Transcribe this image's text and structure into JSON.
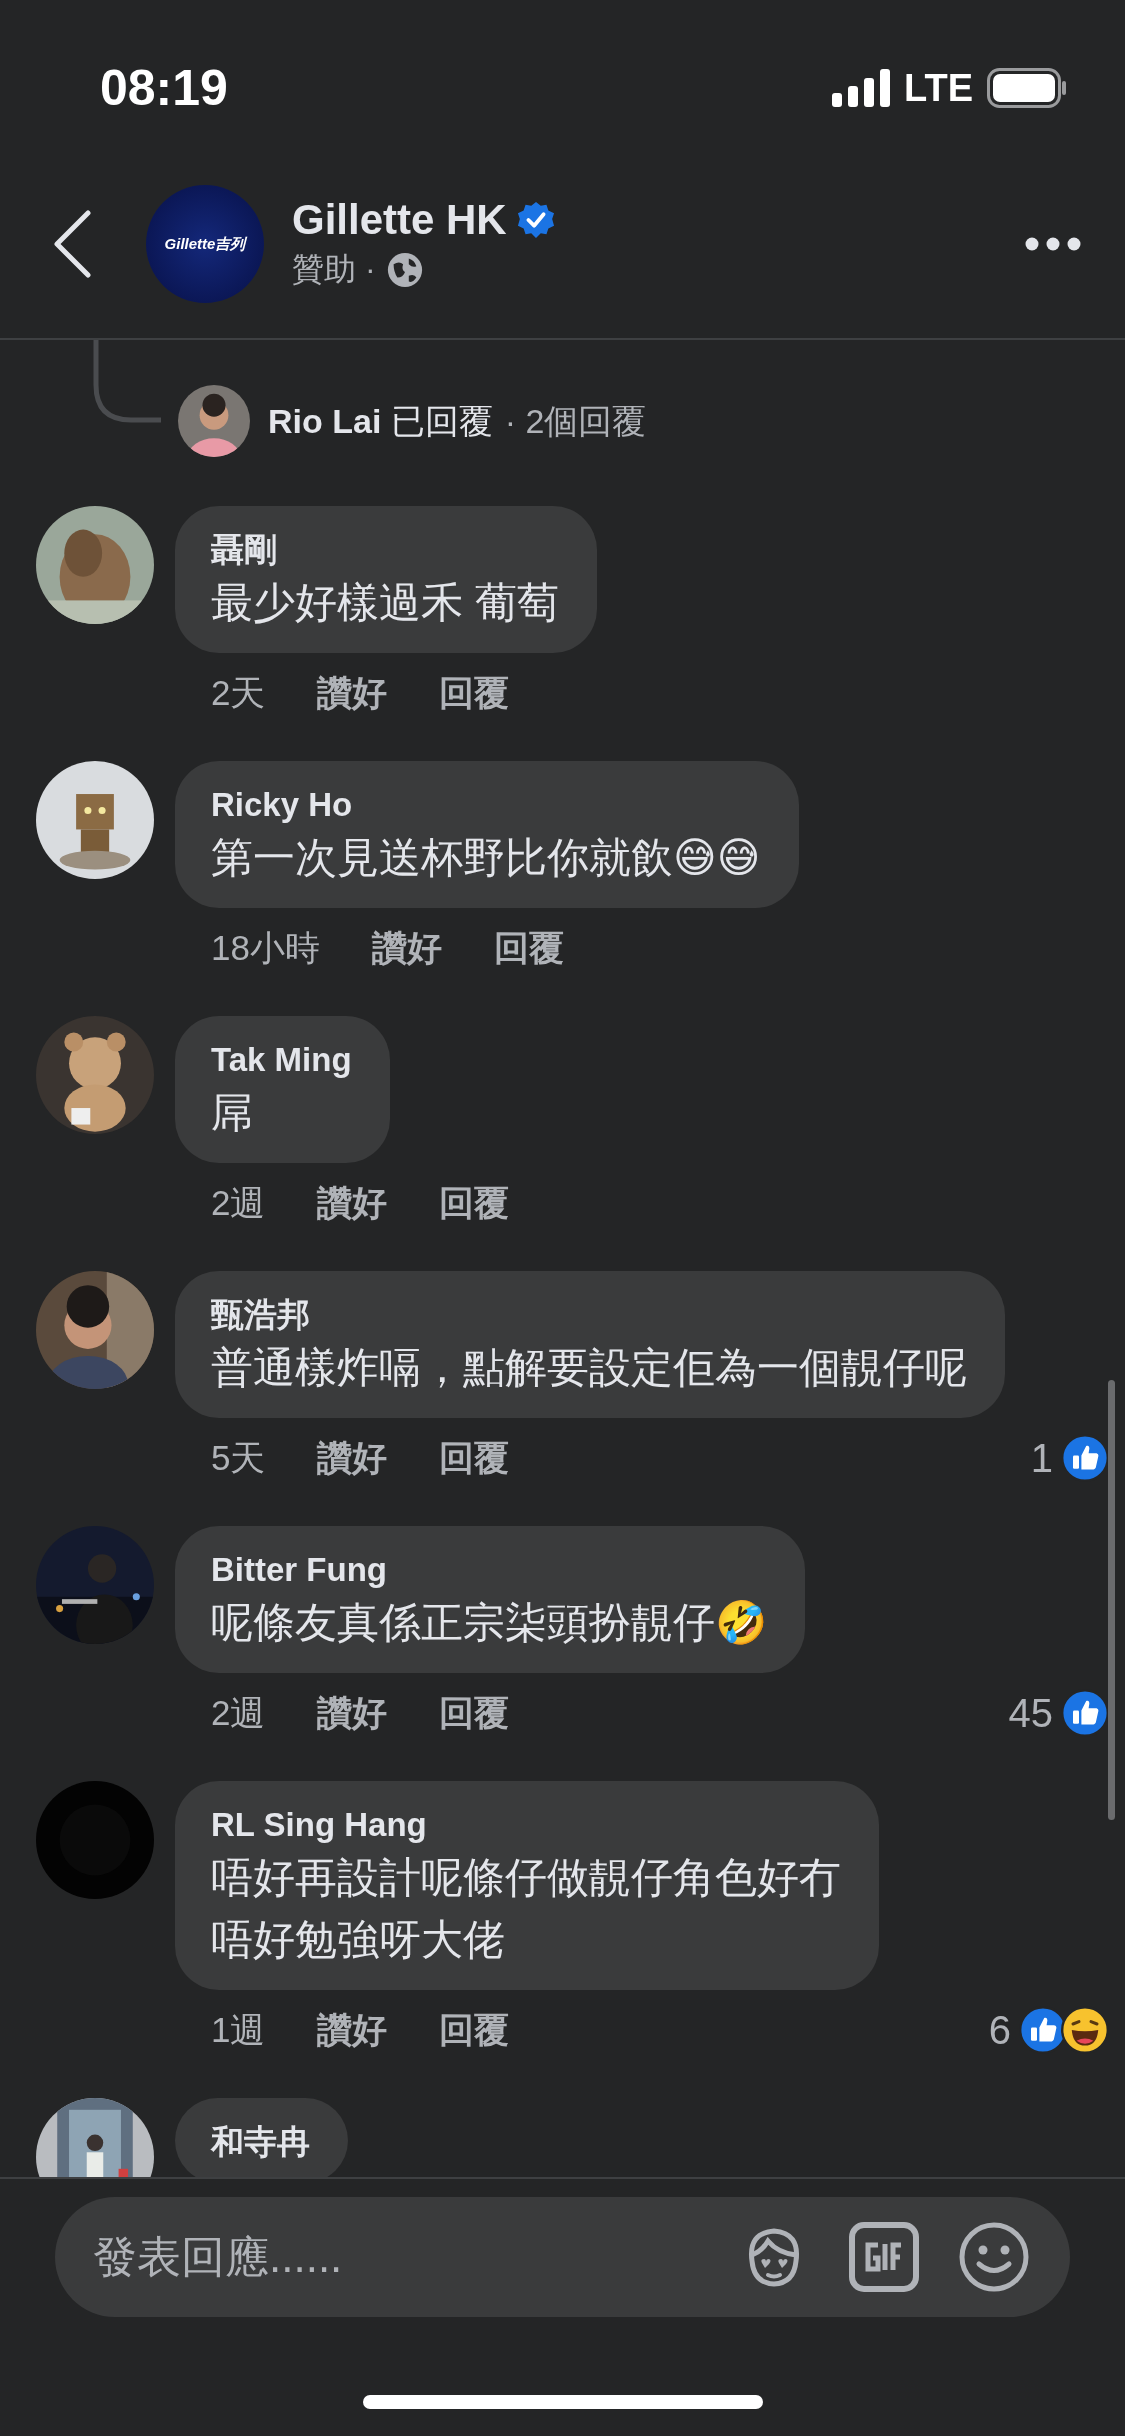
{
  "status_bar": {
    "time": "08:19",
    "network": "LTE"
  },
  "header": {
    "logo_text": "Gillette吉列",
    "title": "Gillette HK",
    "verified": true,
    "subtitle": "贊助 ·"
  },
  "reply_summary": {
    "text": "**Rio Lai** 已回覆",
    "count": "· 2個回覆"
  },
  "comments": [
    {
      "name": "聶剛",
      "lines": [
        "最少好樣過禾 葡萄"
      ],
      "time": "2天",
      "like_label": "讚好",
      "reply_label": "回覆"
    },
    {
      "name": "Ricky Ho",
      "lines": [
        "第一次見送杯野比你就飲😅😅"
      ],
      "time": "18小時",
      "like_label": "讚好",
      "reply_label": "回覆"
    },
    {
      "name": "Tak Ming",
      "lines": [
        "屌"
      ],
      "time": "2週",
      "like_label": "讚好",
      "reply_label": "回覆"
    },
    {
      "name": "甄浩邦",
      "lines": [
        "普通樣炸嗝，點解要設定佢為一個靚仔呢"
      ],
      "time": "5天",
      "like_label": "讚好",
      "reply_label": "回覆",
      "reactions": {
        "count": "1",
        "types": [
          {
            "kind": "like"
          }
        ]
      }
    },
    {
      "name": "Bitter Fung",
      "lines": [
        "呢條友真係正宗柒頭扮靚仔🤣"
      ],
      "time": "2週",
      "like_label": "讚好",
      "reply_label": "回覆",
      "reactions": {
        "count": "45",
        "types": [
          {
            "kind": "like"
          }
        ]
      }
    },
    {
      "name": "RL Sing Hang",
      "lines": [
        "唔好再設計呢條仔做靚仔角色好冇",
        "唔好勉強呀大佬"
      ],
      "time": "1週",
      "like_label": "讚好",
      "reply_label": "回覆",
      "reactions": {
        "count": "6",
        "types": [
          {
            "kind": "like"
          },
          {
            "kind": "haha"
          }
        ]
      }
    },
    {
      "name": "和寺冉"
    }
  ],
  "composer": {
    "placeholder": "發表回應......"
  }
}
